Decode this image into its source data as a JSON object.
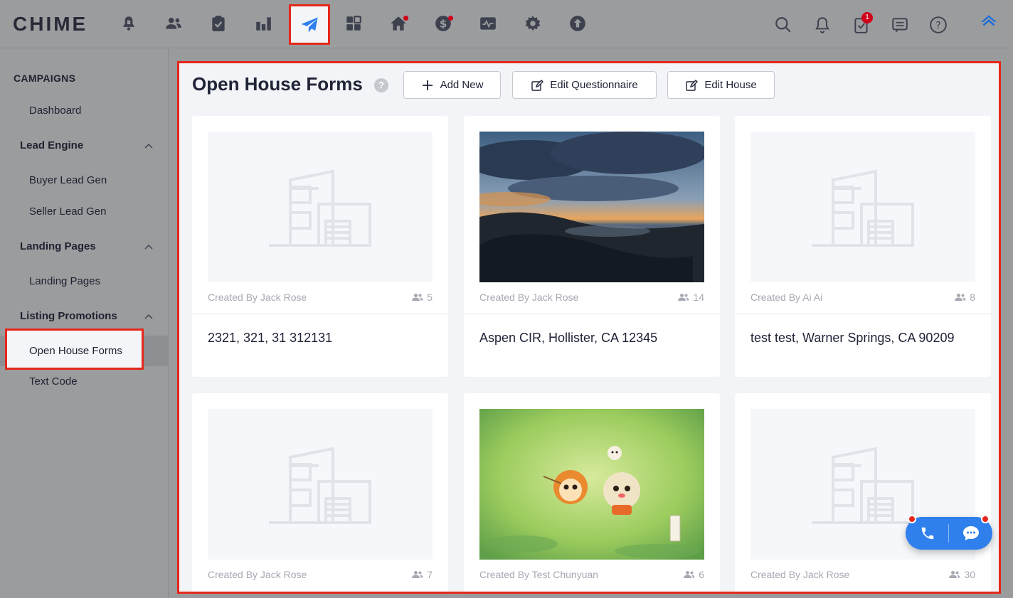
{
  "app": {
    "logo": "CHIME"
  },
  "topbar": {
    "nav_icons": [
      "bell-alert-icon",
      "people-icon",
      "clipboard-check-icon",
      "bar-chart-icon",
      "paper-plane-icon",
      "dashboard-grid-icon",
      "house-icon",
      "dollar-icon",
      "chart-line-icon",
      "gear-icon",
      "upload-icon"
    ],
    "right_icons": [
      "search-icon",
      "notification-bell-icon",
      "task-icon",
      "message-icon",
      "help-icon",
      "brand-icon"
    ],
    "task_badge": "1"
  },
  "sidebar": {
    "header": "CAMPAIGNS",
    "dashboard": "Dashboard",
    "lead_engine": "Lead Engine",
    "buyer_lead_gen": "Buyer Lead Gen",
    "seller_lead_gen": "Seller Lead Gen",
    "landing_pages_group": "Landing Pages",
    "landing_pages": "Landing Pages",
    "listing_promotions": "Listing Promotions",
    "open_house_forms": "Open House Forms",
    "text_code": "Text Code"
  },
  "main": {
    "title": "Open House Forms",
    "help": "?",
    "add_new": "Add New",
    "edit_questionnaire": "Edit Questionnaire",
    "edit_house": "Edit House",
    "cards": [
      {
        "created": "Created By Jack Rose",
        "count": "5",
        "address": "2321, 321, 31 312131",
        "image": "placeholder"
      },
      {
        "created": "Created By Jack Rose",
        "count": "14",
        "address": "Aspen CIR, Hollister, CA 12345",
        "image": "sunset-coast"
      },
      {
        "created": "Created By Ai Ai",
        "count": "8",
        "address": "test test, Warner Springs, CA 90209",
        "image": "placeholder"
      },
      {
        "created": "Created By Jack Rose",
        "count": "7",
        "address": "",
        "image": "placeholder"
      },
      {
        "created": "Created By Test Chunyuan",
        "count": "6",
        "address": "",
        "image": "cartoon-cats"
      },
      {
        "created": "Created By Jack Rose",
        "count": "30",
        "address": "",
        "image": "placeholder"
      }
    ]
  },
  "colors": {
    "accent": "#2f80ed",
    "highlight": "#e5271b"
  }
}
